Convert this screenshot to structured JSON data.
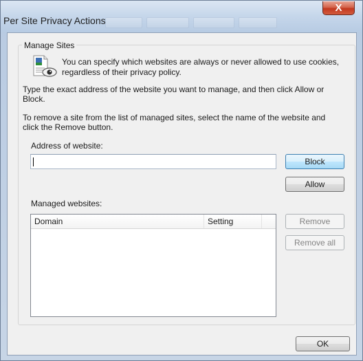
{
  "window": {
    "title": "Per Site Privacy Actions",
    "close_glyph": "X"
  },
  "group": {
    "legend": "Manage Sites",
    "intro": [
      "You can specify which websites are always or never allowed to use cookies,",
      "regardless of their privacy policy."
    ],
    "instruction": [
      "Type the exact address of the website you want to manage, and then click Allow or",
      "Block."
    ],
    "remove_instruction": [
      "To remove a site from the list of managed sites, select the name of the website and",
      "click the Remove button."
    ],
    "address_label": "Address of website:",
    "address_value": "",
    "managed_label": "Managed websites:",
    "columns": [
      "Domain",
      "Setting"
    ],
    "rows": []
  },
  "buttons": {
    "block": "Block",
    "allow": "Allow",
    "remove": "Remove",
    "remove_all": "Remove all",
    "ok": "OK"
  },
  "icons": {
    "privacy": "privacy-document-eye-icon",
    "close": "close-icon"
  }
}
